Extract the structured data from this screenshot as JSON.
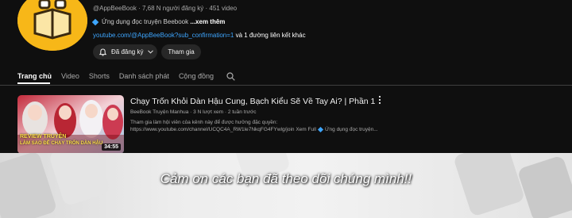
{
  "channel": {
    "handle": "@AppBeeBook",
    "subscribers": "7,68 N người đăng ký",
    "videos": "451 video",
    "description": "Ứng dụng đọc truyện Beebook",
    "more_label": "...xem thêm",
    "link_url": "youtube.com/@AppBeeBook?sub_confirmation=1",
    "link_more": "và 1 đường liên kết khác",
    "subscribed_label": "Đã đăng ký",
    "join_label": "Tham gia",
    "accent": "#3ea6ff",
    "avatar_color": "#f7b718"
  },
  "tabs": [
    {
      "label": "Trang chủ",
      "active": true
    },
    {
      "label": "Video"
    },
    {
      "label": "Shorts"
    },
    {
      "label": "Danh sách phát"
    },
    {
      "label": "Cộng đồng"
    }
  ],
  "video": {
    "title": "Chạy Trốn Khỏi Dàn Hậu Cung, Bạch Kiểu Sẽ Về Tay Ai? | Phần 1",
    "channel": "BeeBook Truyện Manhua",
    "views": "3 N lượt xem",
    "age": "2 tuần trước",
    "desc_line1": "Tham gia làm hội viên của kênh này để được hưởng đặc quyền:",
    "desc_line2": "https://www.youtube.com/channel/UCQC4A_RW1le7NkqFG4FYwlg/join Xem Full",
    "desc_app": "Ứng dụng đọc truyện...",
    "duration": "34:55",
    "thumb_text_1": "REVIEW TRUYỆN",
    "thumb_text_2": "LÀM SAO ĐỂ CHẠY TRỐN DÀN HẬU"
  },
  "footer": {
    "thanks": "Cảm ơn các bạn đã theo dõi chúng mình!!"
  },
  "icons": [
    "bell-icon",
    "chevron-down-icon",
    "search-icon",
    "more-vert-icon",
    "diamond-icon"
  ]
}
